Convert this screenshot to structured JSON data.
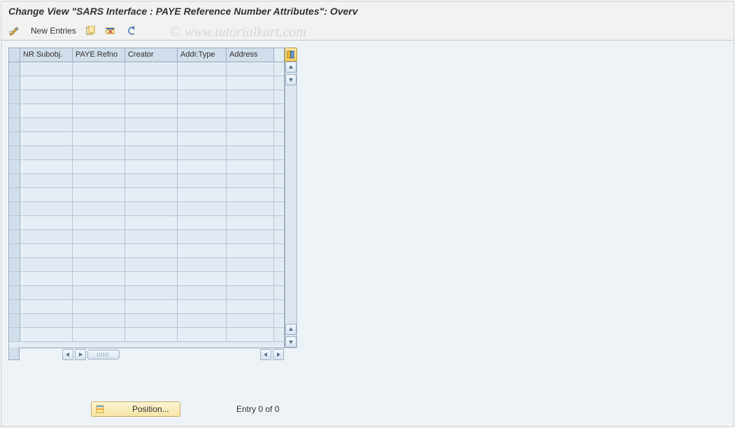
{
  "title": "Change View \"SARS Interface : PAYE Reference Number Attributes\": Overv",
  "toolbar": {
    "new_entries_label": "New Entries"
  },
  "table": {
    "columns": [
      "NR Subobj.",
      "PAYE Refno",
      "Creator",
      "Addr.Type",
      "Address"
    ],
    "row_count": 20
  },
  "footer": {
    "position_label": "Position...",
    "entry_label": "Entry 0 of 0"
  },
  "watermark": "www.tutorialkart.com"
}
